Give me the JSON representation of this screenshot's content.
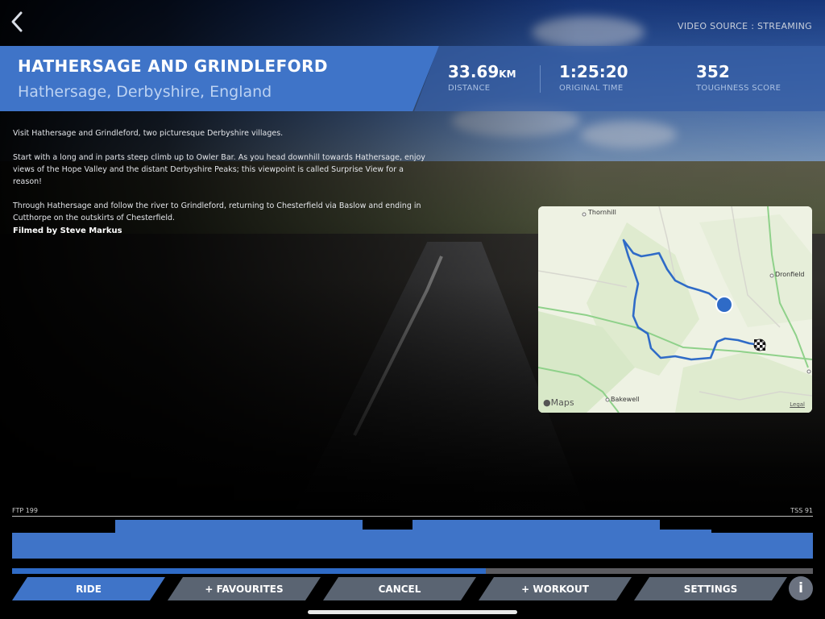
{
  "top": {
    "video_source": "VIDEO SOURCE : STREAMING"
  },
  "header": {
    "title": "HATHERSAGE AND GRINDLEFORD",
    "subtitle": "Hathersage, Derbyshire, England",
    "stats": {
      "distance_value": "33.69",
      "distance_unit": "KM",
      "distance_label": "DISTANCE",
      "time_value": "1:25:20",
      "time_label": "ORIGINAL TIME",
      "toughness_value": "352",
      "toughness_label": "TOUGHNESS SCORE"
    }
  },
  "description": {
    "p1": "Visit Hathersage and Grindleford, two picturesque Derbyshire villages.",
    "p2": "Start with a long and in parts steep climb up to Owler Bar.  As you head downhill towards Hathersage, enjoy views of the Hope Valley and the distant Derbyshire Peaks; this viewpoint is called Surprise View for a reason!",
    "p3": " Through Hathersage and follow the river to Grindleford, returning to Chesterfield via Baslow and ending in Cutthorpe on the outskirts of Chesterfield.",
    "credit": "Filmed by Steve Markus"
  },
  "map": {
    "labels": {
      "thornhill": "Thornhill",
      "dronfield": "Dronfield",
      "bakewell": "Bakewell"
    },
    "brand": "Maps",
    "legal": "Legal"
  },
  "workout": {
    "ftp_label": "FTP 199",
    "tss_label": "TSS 91",
    "progress_fraction": 0.592
  },
  "buttons": {
    "ride": "RIDE",
    "favourites": "+ FAVOURITES",
    "cancel": "CANCEL",
    "workout": "+ WORKOUT",
    "settings": "SETTINGS",
    "info": "i"
  },
  "colors": {
    "accent": "#3f74c8",
    "button_inactive": "#5a6472",
    "route": "#2f6bc7"
  }
}
